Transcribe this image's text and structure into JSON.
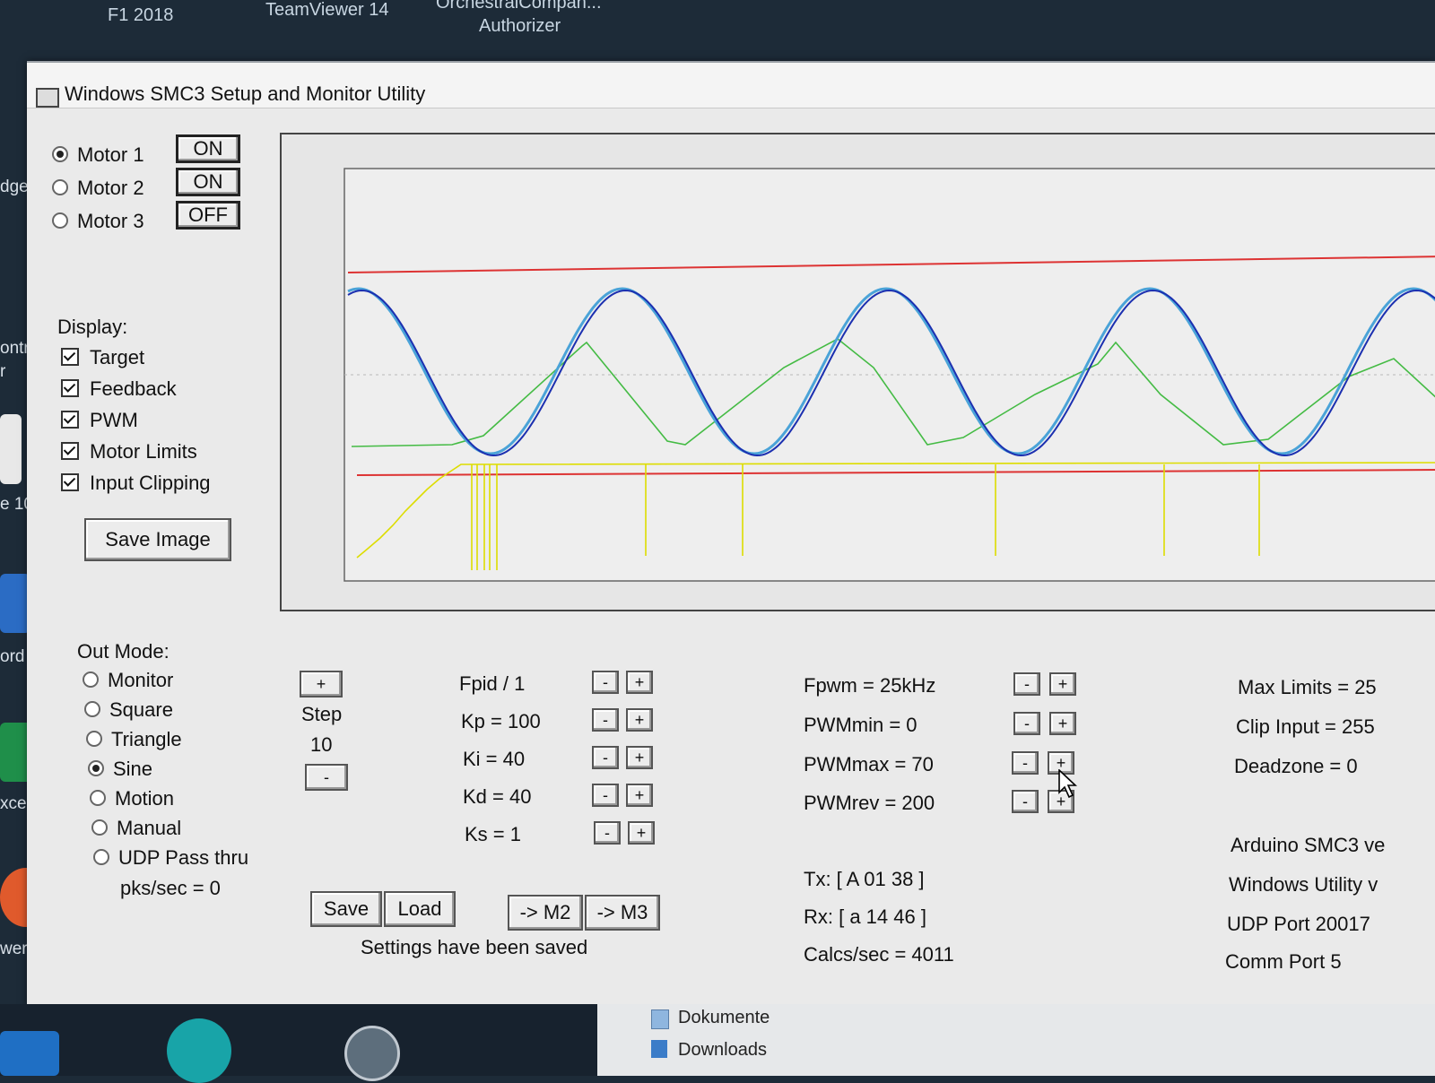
{
  "desktop": {
    "top_icons": [
      "F1 2018",
      "TeamViewer 14",
      "OrchestralCompan...",
      "Authorizer"
    ],
    "left_labels": [
      "dge",
      "ontro",
      "r",
      "e 10",
      "ord",
      "xcel",
      "werPoint"
    ]
  },
  "window": {
    "title": "Windows SMC3 Setup and Monitor Utility"
  },
  "motors": [
    {
      "label": "Motor 1",
      "selected": true,
      "state": "ON"
    },
    {
      "label": "Motor 2",
      "selected": false,
      "state": "ON"
    },
    {
      "label": "Motor 3",
      "selected": false,
      "state": "OFF"
    }
  ],
  "display": {
    "heading": "Display:",
    "options": [
      {
        "label": "Target",
        "checked": true
      },
      {
        "label": "Feedback",
        "checked": true
      },
      {
        "label": "PWM",
        "checked": true
      },
      {
        "label": "Motor Limits",
        "checked": true
      },
      {
        "label": "Input Clipping",
        "checked": true
      }
    ],
    "save_image": "Save Image"
  },
  "out_mode": {
    "heading": "Out Mode:",
    "options": [
      {
        "label": "Monitor",
        "selected": false
      },
      {
        "label": "Square",
        "selected": false
      },
      {
        "label": "Triangle",
        "selected": false
      },
      {
        "label": "Sine",
        "selected": true
      },
      {
        "label": "Motion",
        "selected": false
      },
      {
        "label": "Manual",
        "selected": false
      },
      {
        "label": "UDP Pass thru",
        "selected": false
      }
    ],
    "pks": "pks/sec = 0"
  },
  "step": {
    "plus": "+",
    "label": "Step",
    "value": "10",
    "minus": "-"
  },
  "pid": {
    "rows": [
      "Fpid / 1",
      "Kp = 100",
      "Ki = 40",
      "Kd = 40",
      "Ks = 1"
    ]
  },
  "pwm": {
    "rows": [
      "Fpwm = 25kHz",
      "PWMmin = 0",
      "PWMmax = 70",
      "PWMrev = 200"
    ]
  },
  "limits": {
    "rows": [
      "Max Limits = 25",
      "Clip Input = 255",
      "Deadzone = 0"
    ]
  },
  "info": {
    "rows": [
      "Arduino SMC3 ve",
      "Windows Utility v",
      "UDP Port 20017",
      "Comm Port 5"
    ]
  },
  "comms": {
    "tx": "Tx: [ A 01 38 ]",
    "rx": "Rx: [ a 14 46 ]",
    "calcs": "Calcs/sec = 4011"
  },
  "buttons": {
    "save": "Save",
    "load": "Load",
    "to_m2": "-> M2",
    "to_m3": "-> M3"
  },
  "status": "Settings have been saved",
  "spin": {
    "minus": "-",
    "plus": "+"
  },
  "explorer": {
    "items": [
      "Dokumente",
      "Downloads"
    ]
  },
  "colors": {
    "target": "#4aa3d8",
    "feedback": "#1b2fb0",
    "pwm": "#44bb44",
    "limits": "#dd3333",
    "clipping": "#dddd00"
  }
}
